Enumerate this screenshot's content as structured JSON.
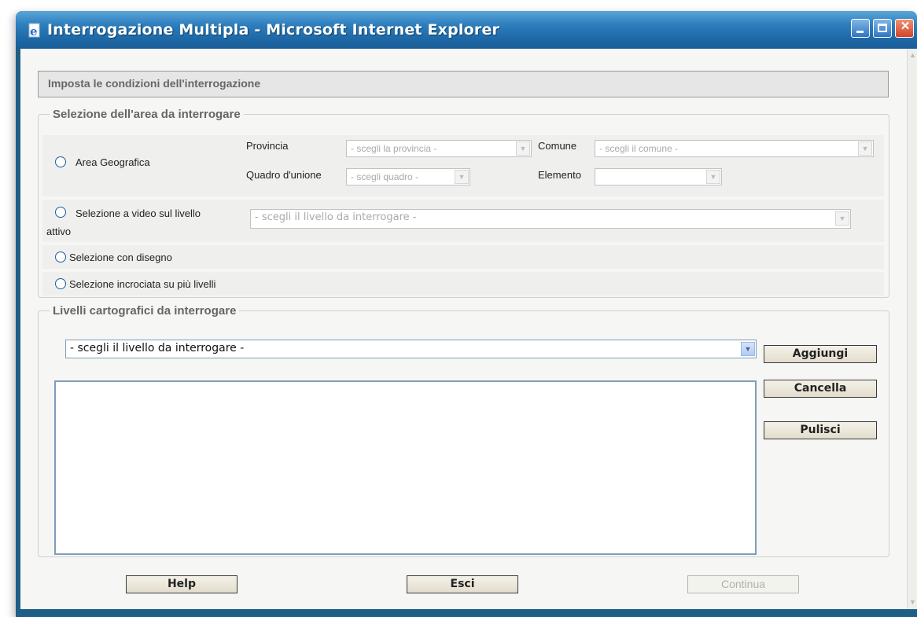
{
  "window": {
    "title": "Interrogazione Multipla - Microsoft Internet Explorer"
  },
  "header": {
    "title": "Imposta le condizioni dell'interrogazione"
  },
  "area_selection": {
    "legend": "Selezione dell'area da interrogare",
    "area_geografica": {
      "label": "Area Geografica",
      "provincia_label": "Provincia",
      "provincia_value": "- scegli la provincia -",
      "comune_label": "Comune",
      "comune_value": "- scegli il comune -",
      "quadro_label": "Quadro d'unione",
      "quadro_value": "- scegli quadro -",
      "elemento_label": "Elemento",
      "elemento_value": ""
    },
    "selezione_video": {
      "label_line1": "Selezione a video sul livello",
      "label_line2": "attivo",
      "livello_value": "- scegli il livello da interrogare -"
    },
    "selezione_disegno": {
      "label": "Selezione con disegno"
    },
    "selezione_incrociata": {
      "label": "Selezione incrociata su più livelli"
    }
  },
  "livelli": {
    "legend": "Livelli cartografici da interrogare",
    "livello_value": "- scegli il livello da interrogare -",
    "aggiungi": "Aggiungi",
    "cancella": "Cancella",
    "pulisci": "Pulisci"
  },
  "footer": {
    "help": "Help",
    "esci": "Esci",
    "continua": "Continua"
  },
  "icons": {
    "app": "ie-page-icon",
    "minimize": "minimize-icon",
    "maximize": "maximize-icon",
    "close": "close-icon",
    "dropdown": "chevron-down-icon"
  },
  "colors": {
    "titlebar": "#2f7fbf",
    "frame": "#1f5f86",
    "close_button": "#d2442a",
    "radio_border": "#1d5aa0"
  }
}
